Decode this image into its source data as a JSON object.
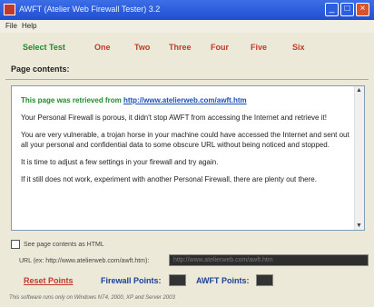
{
  "window": {
    "title": "AWFT (Atelier Web Firewall Tester) 3.2",
    "controls": {
      "minimize": "_",
      "maximize": "□",
      "close": "×"
    }
  },
  "menu": {
    "file": "File",
    "help": "Help"
  },
  "tabs": {
    "select_test": "Select Test",
    "items": [
      "One",
      "Two",
      "Three",
      "Four",
      "Five",
      "Six"
    ]
  },
  "page_contents": {
    "label": "Page contents:",
    "retrieved_prefix": "This page was retrieved from",
    "retrieved_url": "http://www.atelierweb.com/awft.htm",
    "paragraphs": [
      "Your Personal Firewall is porous, it didn't stop AWFT from accessing the Internet and retrieve it!",
      "You are very vulnerable, a trojan horse in your machine could have accessed the Internet and sent out all your personal and confidential data to some obscure URL without being noticed and stopped.",
      "It is time to adjust a few settings in your firewall and try again.",
      "If it still does not work, experiment with another Personal Firewall, there are plenty out there."
    ]
  },
  "options": {
    "show_html_label": "See page contents as HTML",
    "url_label": "URL (ex: http://www.atelierweb.com/awft.htm):",
    "url_value": "http://www.atelierweb.com/awft.htm"
  },
  "scoring": {
    "reset_label": "Reset Points",
    "firewall_points_label": "Firewall Points:",
    "awft_points_label": "AWFT Points:"
  },
  "footer": {
    "text": "This software runs only on Windows NT4, 2000, XP and Server 2003"
  },
  "colors": {
    "title_bar": "#1f4fd0",
    "tab_red": "#c0392b",
    "tab_green": "#1e8a2e",
    "link_blue": "#1a4fb8"
  }
}
